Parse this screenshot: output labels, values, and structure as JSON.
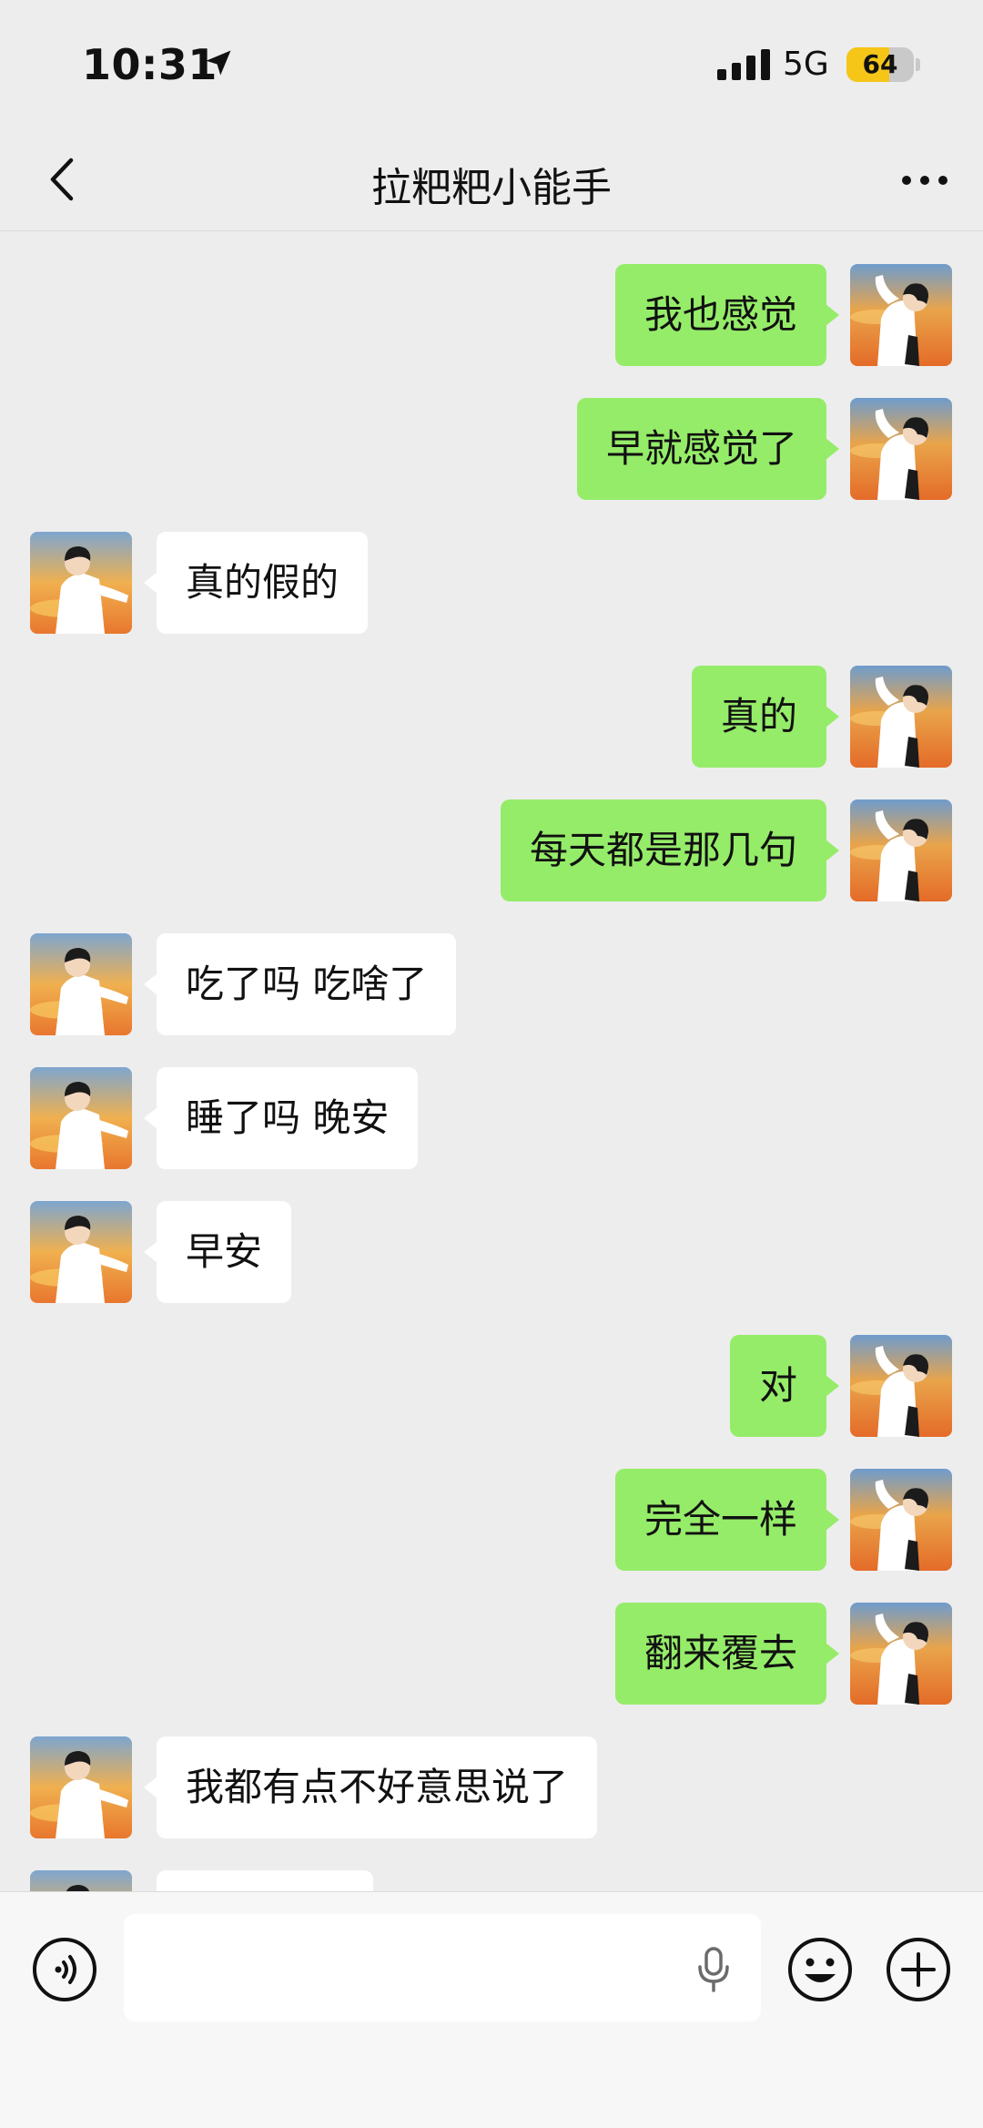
{
  "status_bar": {
    "time": "10:31",
    "network": "5G",
    "battery_level": "64",
    "battery_fraction": 0.64,
    "battery_color": "#f5c518"
  },
  "header": {
    "back_icon": "chevron-left-icon",
    "title": "拉粑粑小能手",
    "more_icon": "more-dots-icon"
  },
  "colors": {
    "background": "#ededed",
    "sent_bubble": "#95ec69",
    "received_bubble": "#ffffff"
  },
  "messages": [
    {
      "side": "sent",
      "text": "我也感觉"
    },
    {
      "side": "sent",
      "text": "早就感觉了"
    },
    {
      "side": "received",
      "text": "真的假的"
    },
    {
      "side": "sent",
      "text": "真的"
    },
    {
      "side": "sent",
      "text": "每天都是那几句"
    },
    {
      "side": "received",
      "text": "吃了吗 吃啥了"
    },
    {
      "side": "received",
      "text": "睡了吗 晚安"
    },
    {
      "side": "received",
      "text": "早安"
    },
    {
      "side": "sent",
      "text": "对"
    },
    {
      "side": "sent",
      "text": "完全一样"
    },
    {
      "side": "sent",
      "text": "翻来覆去"
    },
    {
      "side": "received",
      "text": "我都有点不好意思说了"
    },
    {
      "side": "received",
      "text": ""
    }
  ],
  "input_bar": {
    "voice_icon": "voice-wave-icon",
    "input_value": "",
    "mic_icon": "microphone-icon",
    "emoji_icon": "smiley-face-icon",
    "plus_icon": "plus-circle-icon"
  }
}
